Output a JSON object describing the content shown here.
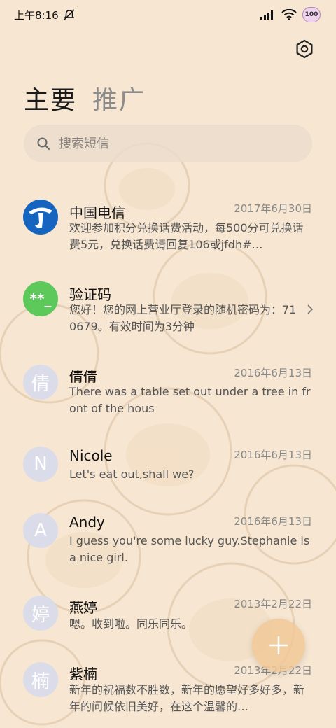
{
  "status_bar": {
    "time": "上午8:16",
    "battery": "100",
    "icons": [
      "mute-icon",
      "signal-icon",
      "wifi-icon",
      "battery-icon"
    ]
  },
  "tabs": [
    {
      "label": "主要",
      "active": true
    },
    {
      "label": "推广",
      "active": false
    }
  ],
  "search": {
    "placeholder": "搜索短信",
    "value": ""
  },
  "conversations": [
    {
      "name": "中国电信",
      "date": "2017年6月30日",
      "preview": "欢迎参加积分兑换话费活动，每500分可兑换话费5元，兑换话费请回复106或jfdh#…",
      "avatar": "telecom-logo"
    },
    {
      "name": "验证码",
      "date": "",
      "preview": "您好！您的网上营业厅登录的随机密码为：710679。有效时间为3分钟",
      "avatar": "**_"
    },
    {
      "name": "倩倩",
      "date": "2016年6月13日",
      "preview": "There was a table set out under a tree in front of the hous",
      "avatar": "倩"
    },
    {
      "name": "Nicole",
      "date": "2016年6月13日",
      "preview": "Let's eat out,shall we?",
      "avatar": "N"
    },
    {
      "name": "Andy",
      "date": "2016年6月13日",
      "preview": "I guess you're some lucky guy.Stephanie is a nice girl.",
      "avatar": "A"
    },
    {
      "name": "燕婷",
      "date": "2013年2月22日",
      "preview": "嗯。收到啦。同乐同乐。",
      "avatar": "婷"
    },
    {
      "name": "紫楠",
      "date": "2013年2月22日",
      "preview": "新年的祝福数不胜数，新年的愿望好多好多，新年的问候依旧美好，在这个温馨的…",
      "avatar": "楠"
    }
  ],
  "colors": {
    "background": "#f6e6d2",
    "verification_avatar": "#5cc95a",
    "telecom_blue": "#1565c0"
  }
}
